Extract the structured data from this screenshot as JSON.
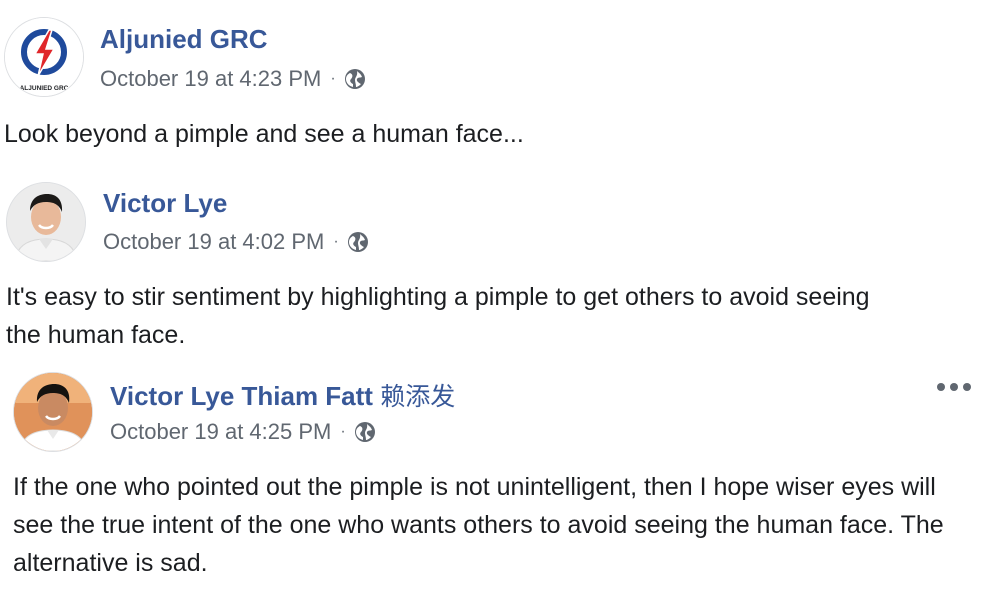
{
  "posts": [
    {
      "author": "Aljunied GRC",
      "timestamp": "October 19 at 4:23 PM",
      "separator": "·",
      "privacy_icon": "globe-icon",
      "avatar_text": "ALJUNIED GRC",
      "text": "Look beyond a pimple and see a human face..."
    },
    {
      "author": "Victor Lye",
      "timestamp": "October 19 at 4:02 PM",
      "separator": "·",
      "privacy_icon": "globe-icon",
      "text": "It's easy to stir sentiment by highlighting a pimple to get others to avoid seeing the human face."
    },
    {
      "author": "Victor Lye Thiam Fatt",
      "author_suffix": "赖添发",
      "timestamp": "October 19 at 4:25 PM",
      "separator": "·",
      "privacy_icon": "globe-icon",
      "more_icon": "more-options-icon",
      "text": "If the one who pointed out the pimple is not unintelligent, then I hope wiser eyes will see the true intent of the one who wants others to avoid seeing the human face. The alternative is sad."
    }
  ],
  "colors": {
    "author_link": "#385898",
    "meta_text": "#606770",
    "body_text": "#1c1e21",
    "party_blue": "#1f4a9c",
    "party_red": "#e0262a"
  }
}
